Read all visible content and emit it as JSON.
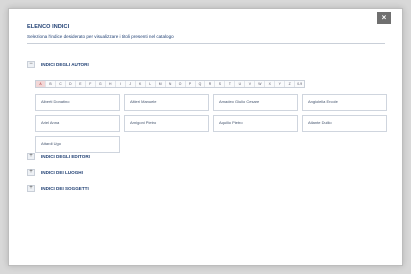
{
  "dialog": {
    "title": "ELENCO INDICI",
    "subtitle": "Seleziona l'indice desiderato per visualizzare i titoli presenti nel catalogo",
    "close_icon": "×"
  },
  "sections": [
    {
      "label": "INDICI DEGLI AUTORI",
      "toggle": "−",
      "expanded": true
    },
    {
      "label": "INDICI DEGLI EDITORI",
      "toggle": "+",
      "expanded": false
    },
    {
      "label": "INDICI DEI LUOGHI",
      "toggle": "+",
      "expanded": false
    },
    {
      "label": "INDICI DEI SOGGETTI",
      "toggle": "+",
      "expanded": false
    }
  ],
  "letters": [
    "A",
    "B",
    "C",
    "D",
    "E",
    "F",
    "G",
    "H",
    "I",
    "J",
    "K",
    "L",
    "M",
    "N",
    "O",
    "P",
    "Q",
    "R",
    "S",
    "T",
    "U",
    "V",
    "W",
    "X",
    "Y",
    "Z",
    "0-9"
  ],
  "active_letter": "A",
  "authors": [
    "Alberti Donatino",
    "Altieri Manuele",
    "Amadeo Giulio Cesare",
    "Angiolella Ercole",
    "Ariel Anna",
    "Arnigoni Pietro",
    "Aquilio Pietro",
    "Atlante Duilio",
    "Attardi Ugo"
  ],
  "colors": {
    "accent": "#1f3f73",
    "close_bg": "#6f6f6f",
    "active_letter_bg": "#f3d7d7"
  }
}
